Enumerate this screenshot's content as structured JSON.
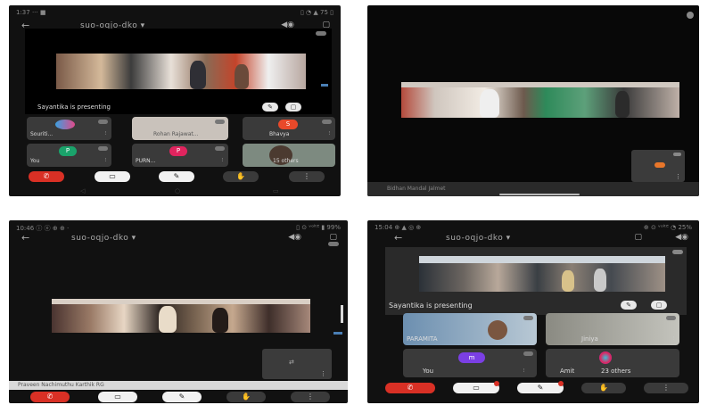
{
  "colors": {
    "end_call": "#d93025",
    "accent_blue": "#4a7fb5",
    "avatar_p": "#e0245e",
    "avatar_m": "#7b3fe4",
    "avatar_s": "#e8492a"
  },
  "panel1": {
    "status_left": "1:37 ···  ■",
    "status_right": "▯ ◔ ▲ 75 ▯",
    "back_icon": "←",
    "meeting_code": "suo-oqjo-dko ▾",
    "volume_icon": "◀◉",
    "camera_icon": "▢",
    "presenting_text": "Sayantika is presenting",
    "tiles": [
      {
        "name": "Souriti...",
        "mic": "⫶"
      },
      {
        "name": "Rohan Rajawat...",
        "mic": ""
      },
      {
        "name": "Bhavya",
        "mic": "⫶",
        "avatar": "S"
      },
      {
        "name": "You",
        "mic": "⫶",
        "avatar": "P"
      },
      {
        "name": "PURN...",
        "mic": "⫶",
        "avatar": "P"
      },
      {
        "name": "15 others",
        "mic": ""
      }
    ],
    "controls": [
      "✆",
      "▭",
      "✎",
      "✋",
      "⋮"
    ]
  },
  "panel2": {
    "bottom_name": "Bidhan Mandal Jalmet",
    "mini_icon": "⋮"
  },
  "panel3": {
    "status_left": "10:46 ⓘ ⓔ ⊕ ⊕ ·",
    "status_right": "▯ ⊙ ᵛᵒˡᵗᴱ ▮ 99%",
    "back_icon": "←",
    "meeting_code": "suo-oqjo-dko ▾",
    "volume_icon": "◀◉",
    "camera_icon": "▢",
    "bottom_name": "Praveen Nachimuthu Karthik RG",
    "mini_icon": "⋮",
    "controls": [
      "✆",
      "▭",
      "✎",
      "✋",
      "⋮"
    ]
  },
  "panel4": {
    "status_left": "15:04 ⊕ ▲ ◎ ⊕",
    "status_right": "⊕ ⊙ ᵛᵒˡᵗᴱ ◔ 25%",
    "back_icon": "←",
    "meeting_code": "suo-oqjo-dko ▾",
    "camera_icon": "▢",
    "volume_icon": "◀◉",
    "presenting_text": "Sayantika is presenting",
    "tiles": [
      {
        "name": "PARAMITA",
        "mic": ""
      },
      {
        "name": "Jiniya",
        "mic": "⫶"
      },
      {
        "name": "You",
        "mic": "⫶",
        "avatar": "m"
      },
      {
        "name": "Amit",
        "mic": "",
        "extra": "23 others"
      }
    ],
    "controls": [
      "✆",
      "▭",
      "✎",
      "✋",
      "⋮"
    ]
  }
}
